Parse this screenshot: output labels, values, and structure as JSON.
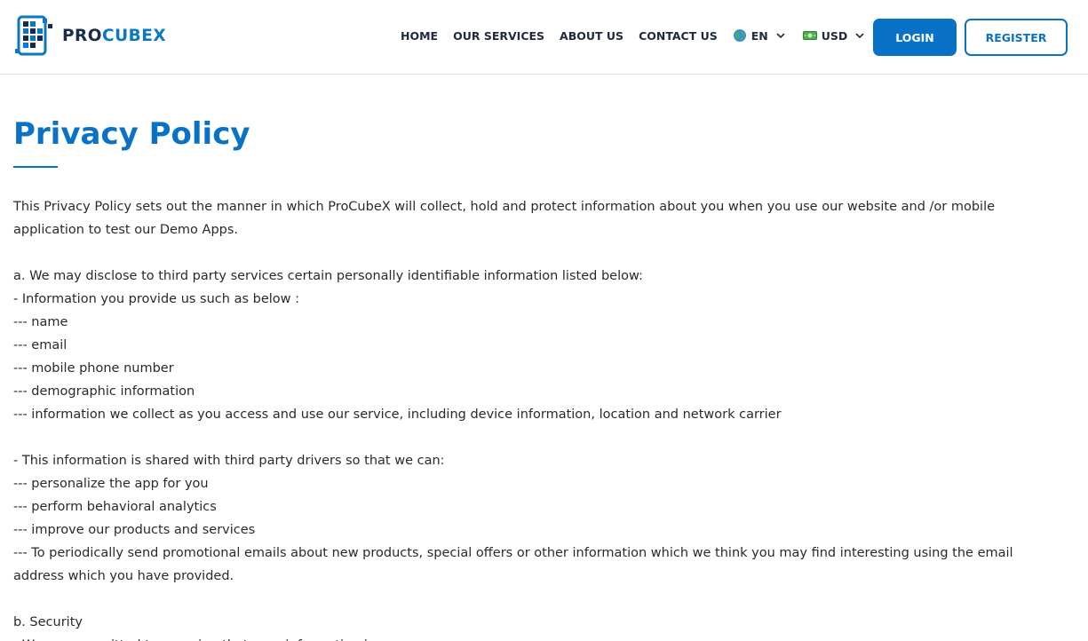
{
  "brand": {
    "logo_pro": "PRO",
    "logo_cubex": "CUBEX"
  },
  "nav": {
    "home": "HOME",
    "services": "OUR SERVICES",
    "about": "ABOUT US",
    "contact": "CONTACT US",
    "language": {
      "flag_icon": "globe-icon",
      "selected": "EN"
    },
    "currency": {
      "flag_icon": "banknote-icon",
      "selected": "USD"
    },
    "login": "LOGIN",
    "register": "REGISTER"
  },
  "page": {
    "title": "Privacy Policy",
    "intro_1": "This Privacy Policy sets out the manner in which ProCubeX will collect, hold and protect information about you when you use our website and /or mobile",
    "intro_2": "application to test our Demo Apps.",
    "section_a": "a. We may disclose to third party services certain personally identifiable information listed below:",
    "provide_heading": "- Information you provide us such as below :",
    "provide_items": [
      "--- name",
      "--- email",
      "--- mobile phone number",
      "--- demographic information",
      "--- information we collect as you access and use our service, including device information, location and network carrier"
    ],
    "shared_heading": "- This information is shared with third party drivers so that we can:",
    "shared_items": [
      "--- personalize the app for you",
      "--- perform behavioral analytics",
      "--- improve our products and services",
      "--- To periodically send promotional emails about new products, special offers or other information which we think you may find interesting using the email",
      "address which you have provided."
    ],
    "section_b": "b. Security",
    "section_b_cut": "- We are committed to ensuring that your information is secure."
  },
  "colors": {
    "primary": "#0a72c6",
    "navy": "#1a2b4c",
    "text": "#2a2a2a"
  }
}
